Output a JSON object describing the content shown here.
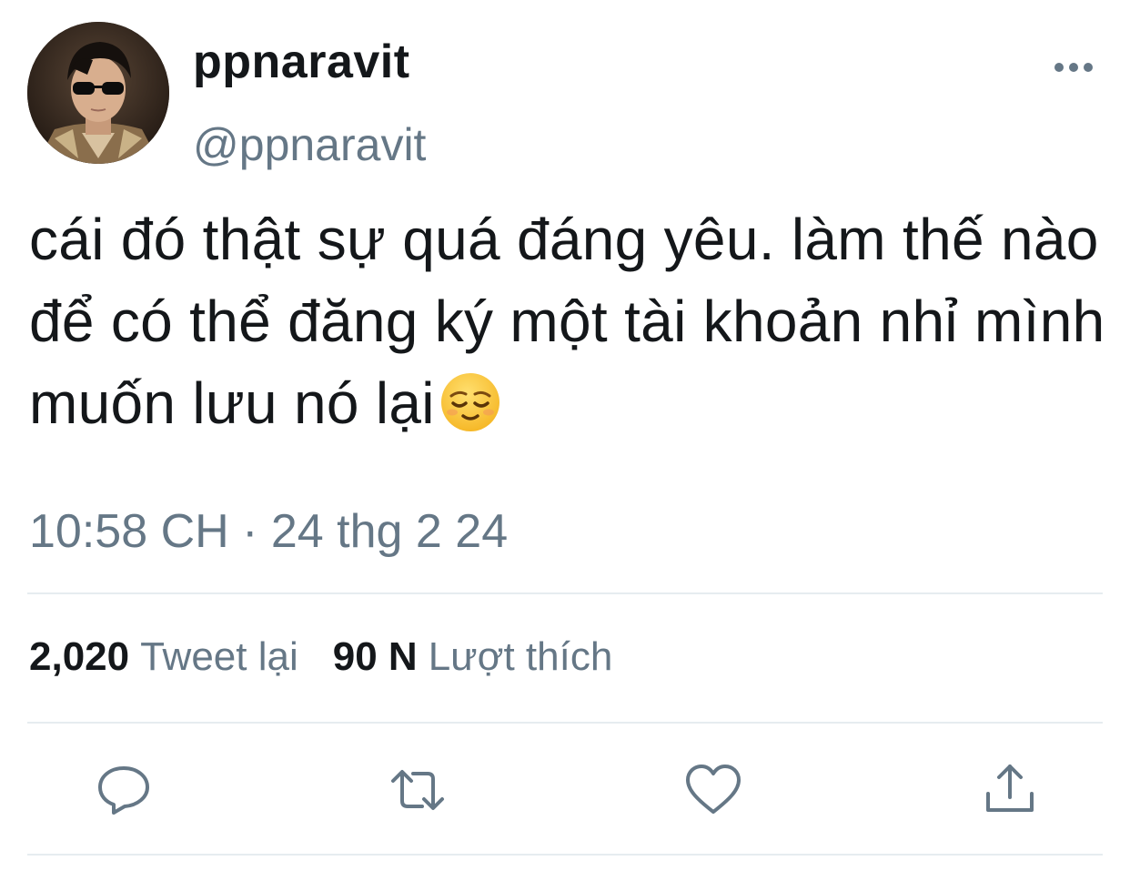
{
  "user": {
    "display_name": "ppnaravit",
    "handle": "@ppnaravit",
    "avatar": "profile-photo"
  },
  "tweet": {
    "text": "cái đó thật sự quá đáng yêu. làm thế nào để có thể đăng ký một tài khoản nhỉ mình muốn lưu nó lại",
    "emoji": "relieved-face",
    "timestamp": "10:58 CH · 24 thg 2 24"
  },
  "stats": {
    "retweets_count": "2,020",
    "retweets_label": "Tweet lại",
    "likes_count": "90 N",
    "likes_label": "Lượt thích"
  },
  "actions": {
    "icons": [
      "comment-icon",
      "retweet-icon",
      "like-icon",
      "share-icon"
    ]
  },
  "colors": {
    "text_primary": "#14171a",
    "text_secondary": "#657786",
    "icon": "#657786",
    "divider": "#e6ecf0"
  }
}
